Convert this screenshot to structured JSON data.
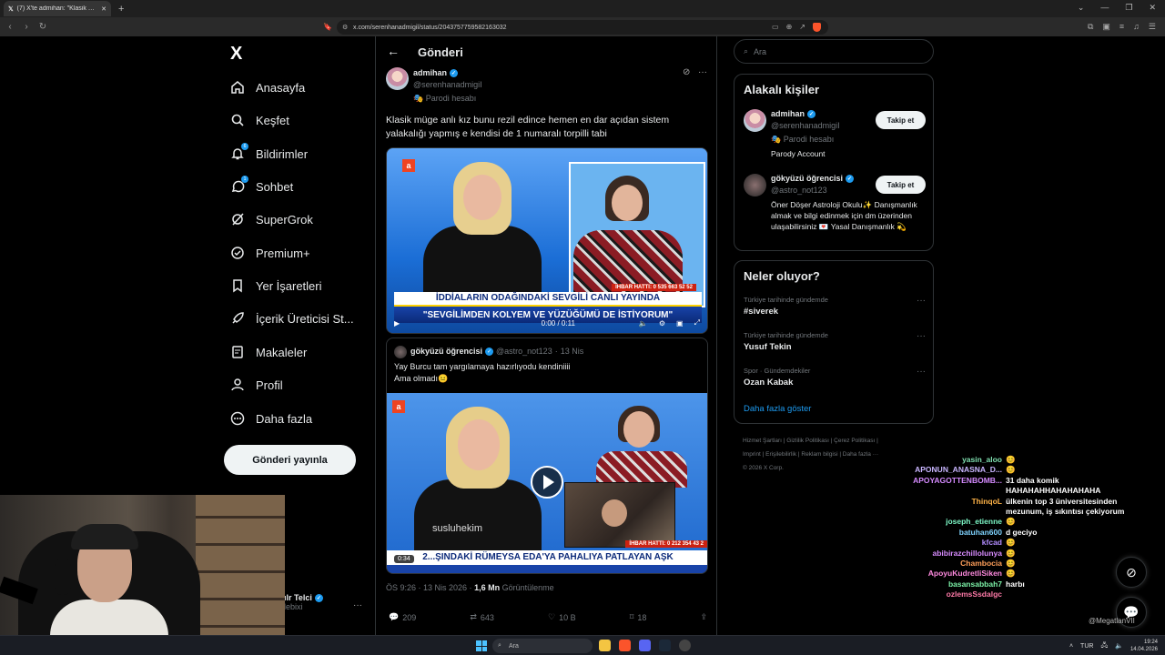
{
  "browser": {
    "tab_title": "(7) X'te admihan: \"Klasik müge...",
    "url": "x.com/serenhanadmigil/status/2043757759582163032"
  },
  "nav": {
    "logo": "X",
    "items": [
      {
        "label": "Anasayfa",
        "icon": "home-icon"
      },
      {
        "label": "Keşfet",
        "icon": "search-icon"
      },
      {
        "label": "Bildirimler",
        "icon": "bell-icon",
        "badge": "6"
      },
      {
        "label": "Sohbet",
        "icon": "chat-icon",
        "badge": "1"
      },
      {
        "label": "SuperGrok",
        "icon": "grok-icon"
      },
      {
        "label": "Premium+",
        "icon": "premium-icon"
      },
      {
        "label": "Yer İşaretleri",
        "icon": "bookmark-icon"
      },
      {
        "label": "İçerik Üreticisi St...",
        "icon": "rocket-icon"
      },
      {
        "label": "Makaleler",
        "icon": "article-icon"
      },
      {
        "label": "Profil",
        "icon": "profile-icon"
      },
      {
        "label": "Daha fazla",
        "icon": "more-icon"
      }
    ],
    "post_button": "Gönderi yayınla",
    "account_name": "ılr Telci",
    "account_handle": "lebixi"
  },
  "post": {
    "header": "Gönderi",
    "author": "admihan",
    "handle": "@serenhanadmigiI",
    "parody": "Parodi hesabı",
    "text": "Klasik müge anlı kız bunu rezil edince hemen en dar açıdan sistem yalakalığı yapmış e kendisi de 1 numaralı torpilli tabi",
    "video": {
      "channel": "atv",
      "hotline": "İHBAR HATTI: 0 535 663 52 52",
      "ticker_top": "İDDİALARIN ODAĞINDAKİ SEVGİLİ CANLI YAYINDA",
      "ticker_bottom": "\"SEVGİLİMDEN KOLYEM VE YÜZÜĞÜMÜ DE İSTİYORUM\"",
      "time": "0:00 / 0:11"
    },
    "quote": {
      "author": "gökyüzü öğrencisi",
      "handle": "@astro_not123",
      "date": "13 Nis",
      "line1": "Yay Burcu tam yargılamaya hazırlıyodu kendiniiii",
      "line2": "Ama olmadı😐",
      "watermark": "susluhekim",
      "hotline": "İHBAR HATTI: 0 212 354 43 2",
      "ticker": "2...ŞINDAKİ RÜMEYSA EDA'YA PAHALIYA PATLAYAN AŞK",
      "duration": "0:34"
    },
    "meta_time": "ÖS 9:26 · 13 Nis 2026 · ",
    "meta_views": "1,6 Mn",
    "meta_views_label": " Görüntülenme",
    "actions": {
      "replies": "209",
      "reposts": "643",
      "likes": "10 B",
      "bookmarks": "18"
    }
  },
  "sidebar": {
    "search_placeholder": "Ara",
    "related_title": "Alakalı kişiler",
    "related": [
      {
        "name": "admihan",
        "handle": "@serenhanadmigiI",
        "extra": "Parodi hesabı",
        "bio": "Parody Account",
        "follow": "Takip et"
      },
      {
        "name": "gökyüzü öğrencisi",
        "handle": "@astro_not123",
        "bio": "Öner Döşer Astroloji Okulu✨ Danışmanlık almak ve bilgi edinmek için dm üzerinden ulaşabilirsiniz 💌 Yasal Danışmanlık 💫",
        "follow": "Takip et"
      }
    ],
    "trends_title": "Neler oluyor?",
    "trends": [
      {
        "category": "Türkiye tarihinde gündemde",
        "name": "#siverek"
      },
      {
        "category": "Türkiye tarihinde gündemde",
        "name": "Yusuf Tekin"
      },
      {
        "category": "Spor · Gündemdekiler",
        "name": "Ozan Kabak"
      }
    ],
    "show_more": "Daha fazla göster",
    "footer1": "Hizmet Şartları  |  Gizlilik Politikası  |  Çerez Politikası  |",
    "footer2": "Imprint  |  Erişilebilirlik  |  Reklam bilgisi  |  Daha fazla ···",
    "footer3": "© 2026 X Corp."
  },
  "chat": [
    {
      "user": "yasin_aloo",
      "text": "😊",
      "color": "#7fe0b0"
    },
    {
      "user": "APONUN_ANASNA_D...",
      "text": "😊",
      "color": "#c9b6ff"
    },
    {
      "user": "APOYAGOTTENBOMB...",
      "text": "31 daha komik HAHAHAHHAHAHAHAHA",
      "color": "#d58bff"
    },
    {
      "user": "ThinqoL",
      "text": "ülkenin top 3 üniversitesinden mezunum, iş sıkıntısı çekiyorum",
      "color": "#ffb347"
    },
    {
      "user": "joseph_etienne",
      "text": "😊",
      "color": "#7df9c8"
    },
    {
      "user": "batuhan600",
      "text": "d geciyo",
      "color": "#7fd3ff"
    },
    {
      "user": "kfcad",
      "text": "😊",
      "color": "#b28cff"
    },
    {
      "user": "abibirazchillolunya",
      "text": "😊",
      "color": "#d88cff"
    },
    {
      "user": "Chambocia",
      "text": "😊",
      "color": "#ff9f5a"
    },
    {
      "user": "ApoyuKudretliSiken",
      "text": "😊",
      "color": "#ff8adf"
    },
    {
      "user": "basansabbah7",
      "text": "harbı",
      "color": "#7cf2a8"
    },
    {
      "user": "ozlemsSsdalgc",
      "text": "",
      "color": "#ff7aa8"
    }
  ],
  "cam_tag": "@MegatlanVII",
  "taskbar": {
    "search": "Ara",
    "lang": "TUR",
    "time": "19:24",
    "date": "14.04.2026"
  }
}
